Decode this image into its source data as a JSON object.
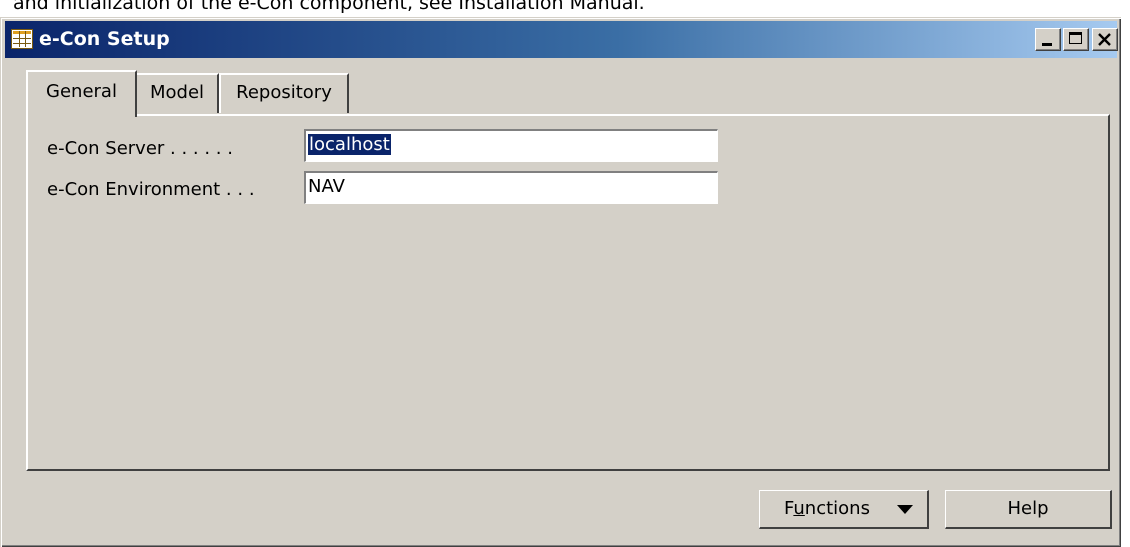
{
  "document": {
    "top_line": "and initialization of the e-Con component, see Installation Manual."
  },
  "window": {
    "title": "e-Con Setup",
    "icon": "table-icon"
  },
  "tabs": [
    {
      "label": "General",
      "active": true
    },
    {
      "label": "Model",
      "active": false
    },
    {
      "label": "Repository",
      "active": false
    }
  ],
  "fields": {
    "server": {
      "label": "e-Con Server . . . . . .",
      "value_selected": "localhost"
    },
    "environment": {
      "label": "e-Con Environment . . .",
      "value": "NAV"
    }
  },
  "buttons": {
    "functions": {
      "label_prefix": "F",
      "label_underlined": "u",
      "label_suffix": "nctions"
    },
    "help": "Help"
  },
  "colors": {
    "title_gradient_start": "#0a246a",
    "title_gradient_end": "#a6caf0",
    "face": "#d4d0c8",
    "selection": "#0a246a"
  }
}
